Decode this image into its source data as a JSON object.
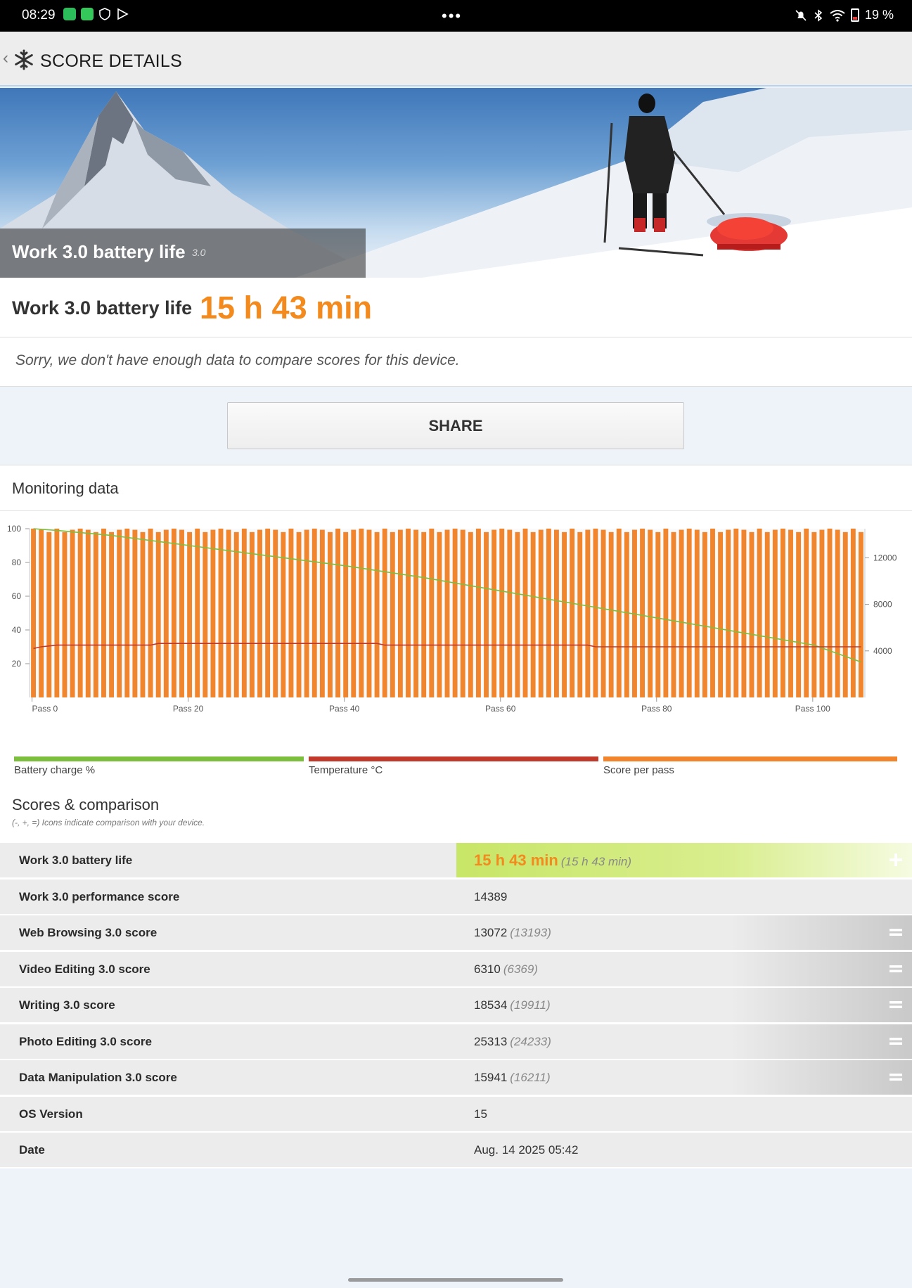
{
  "status_bar": {
    "time": "08:29",
    "battery": "19 %"
  },
  "app_bar": {
    "title": "SCORE DETAILS"
  },
  "hero": {
    "title": "Work 3.0 battery life",
    "version": "3.0"
  },
  "result": {
    "label": "Work 3.0 battery life",
    "value": "15 h 43 min",
    "note": "Sorry, we don't have enough data to compare scores for this device."
  },
  "share_label": "SHARE",
  "monitoring": {
    "title": "Monitoring data",
    "legend": [
      "Battery charge %",
      "Temperature °C",
      "Score per pass"
    ],
    "colors": {
      "battery": "#7cbf3f",
      "temperature": "#c0392b",
      "score": "#f0852e"
    }
  },
  "chart_data": {
    "type": "bar",
    "left_axis_ticks": [
      "100",
      "80",
      "60",
      "40",
      "20"
    ],
    "right_axis_ticks": [
      "12000",
      "8000",
      "4000"
    ],
    "x_ticks": [
      "Pass 0",
      "Pass 20",
      "Pass 40",
      "Pass 60",
      "Pass 80",
      "Pass 100"
    ],
    "ylim_left": [
      0,
      100
    ],
    "ylim_right": [
      0,
      14500
    ],
    "passes": 107,
    "series": [
      {
        "name": "Score per pass",
        "type": "bar",
        "axis": "right",
        "approx_values": 14389
      },
      {
        "name": "Battery charge %",
        "type": "line",
        "axis": "left",
        "x": [
          0,
          3,
          10,
          20,
          30,
          40,
          50,
          60,
          70,
          80,
          90,
          100,
          106
        ],
        "values": [
          100,
          99,
          96,
          90,
          84,
          78,
          71,
          63,
          55,
          47,
          39,
          31,
          21
        ]
      },
      {
        "name": "Temperature °C",
        "type": "line",
        "axis": "left",
        "x": [
          0,
          1,
          3,
          15,
          16,
          44,
          45,
          71,
          72,
          106
        ],
        "values": [
          29,
          30,
          31,
          31,
          32,
          32,
          31,
          31,
          30,
          30
        ]
      }
    ]
  },
  "scores": {
    "title": "Scores & comparison",
    "subtitle": "(-, +, =) Icons indicate comparison with your device.",
    "rows": [
      {
        "label": "Work 3.0 battery life",
        "value": "15 h 43 min",
        "compare": "(15 h 43 min)",
        "icon": "plus-icon"
      },
      {
        "label": "Work 3.0 performance score",
        "value": "14389",
        "compare": "",
        "icon": ""
      },
      {
        "label": "Web Browsing 3.0 score",
        "value": "13072",
        "compare": "(13193)",
        "icon": "equal-icon"
      },
      {
        "label": "Video Editing 3.0 score",
        "value": "6310",
        "compare": "(6369)",
        "icon": "equal-icon"
      },
      {
        "label": "Writing 3.0 score",
        "value": "18534",
        "compare": "(19911)",
        "icon": "equal-icon"
      },
      {
        "label": "Photo Editing 3.0 score",
        "value": "25313",
        "compare": "(24233)",
        "icon": "equal-icon"
      },
      {
        "label": "Data Manipulation 3.0 score",
        "value": "15941",
        "compare": "(16211)",
        "icon": "equal-icon"
      },
      {
        "label": "OS Version",
        "value": "15",
        "compare": "",
        "icon": ""
      },
      {
        "label": "Date",
        "value": "Aug. 14 2025 05:42",
        "compare": "",
        "icon": ""
      }
    ]
  }
}
